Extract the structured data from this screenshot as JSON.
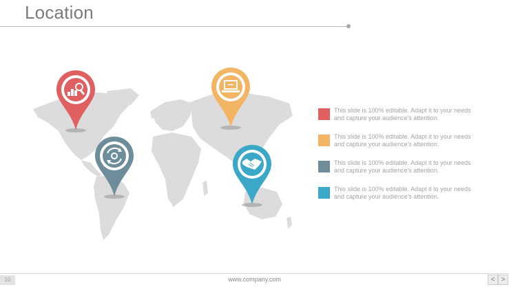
{
  "title": "Location",
  "colors": {
    "red": "#e05f61",
    "orange": "#f3b464",
    "slate": "#6e8d9b",
    "blue": "#3aa8c6",
    "map": "#dcdcdc"
  },
  "pins": [
    {
      "id": "red",
      "color": "#e05f61",
      "icon": "bar-chart-magnifier-icon"
    },
    {
      "id": "orange",
      "color": "#f3b464",
      "icon": "laptop-icon"
    },
    {
      "id": "slate",
      "color": "#6e8d9b",
      "icon": "gear-cycle-icon"
    },
    {
      "id": "blue",
      "color": "#3aa8c6",
      "icon": "handshake-icon"
    }
  ],
  "legend": [
    {
      "color": "#e05f61",
      "text": "This slide is 100% editable. Adapt it to your needs and capture your audience's attention."
    },
    {
      "color": "#f3b464",
      "text": "This slide is 100% editable. Adapt it to your needs and capture your audience's attention."
    },
    {
      "color": "#6e8d9b",
      "text": "This slide is 100% editable. Adapt it to your needs and capture your audience's attention."
    },
    {
      "color": "#3aa8c6",
      "text": "This slide is 100% editable. Adapt it to your needs and capture your audience's attention."
    }
  ],
  "footer": {
    "page_number": "10",
    "url": "www.company.com",
    "prev": "<",
    "next": ">"
  }
}
